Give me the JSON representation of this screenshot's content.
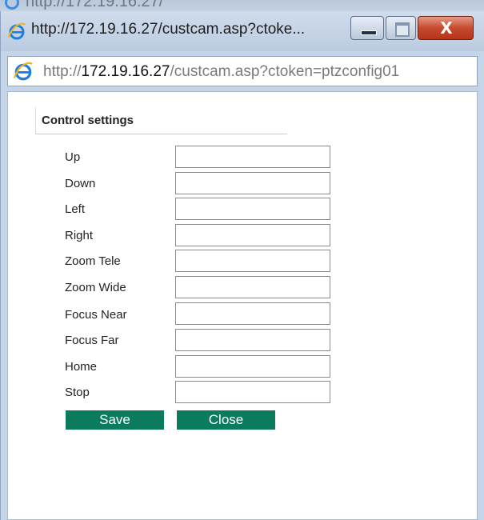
{
  "parent_window": {
    "partial_address": "http://172.19.16.27/"
  },
  "window": {
    "title": "http://172.19.16.27/custcam.asp?ctoke...",
    "close_glyph": "X"
  },
  "addressbar": {
    "scheme": "http://",
    "host": "172.19.16.27",
    "path": "/custcam.asp?ctoken=ptzconfig01"
  },
  "form": {
    "section_title": "Control settings",
    "fields": [
      {
        "label": "Up",
        "value": ""
      },
      {
        "label": "Down",
        "value": ""
      },
      {
        "label": "Left",
        "value": ""
      },
      {
        "label": "Right",
        "value": ""
      },
      {
        "label": "Zoom Tele",
        "value": ""
      },
      {
        "label": "Zoom Wide",
        "value": ""
      },
      {
        "label": "Focus Near",
        "value": ""
      },
      {
        "label": "Focus Far",
        "value": ""
      },
      {
        "label": "Home",
        "value": ""
      },
      {
        "label": "Stop",
        "value": ""
      }
    ],
    "save_label": "Save",
    "close_label": "Close"
  },
  "colors": {
    "button_bg": "#0a7c5d",
    "close_button": "#c74a2f",
    "ie_icon": "#3a8ee6"
  }
}
